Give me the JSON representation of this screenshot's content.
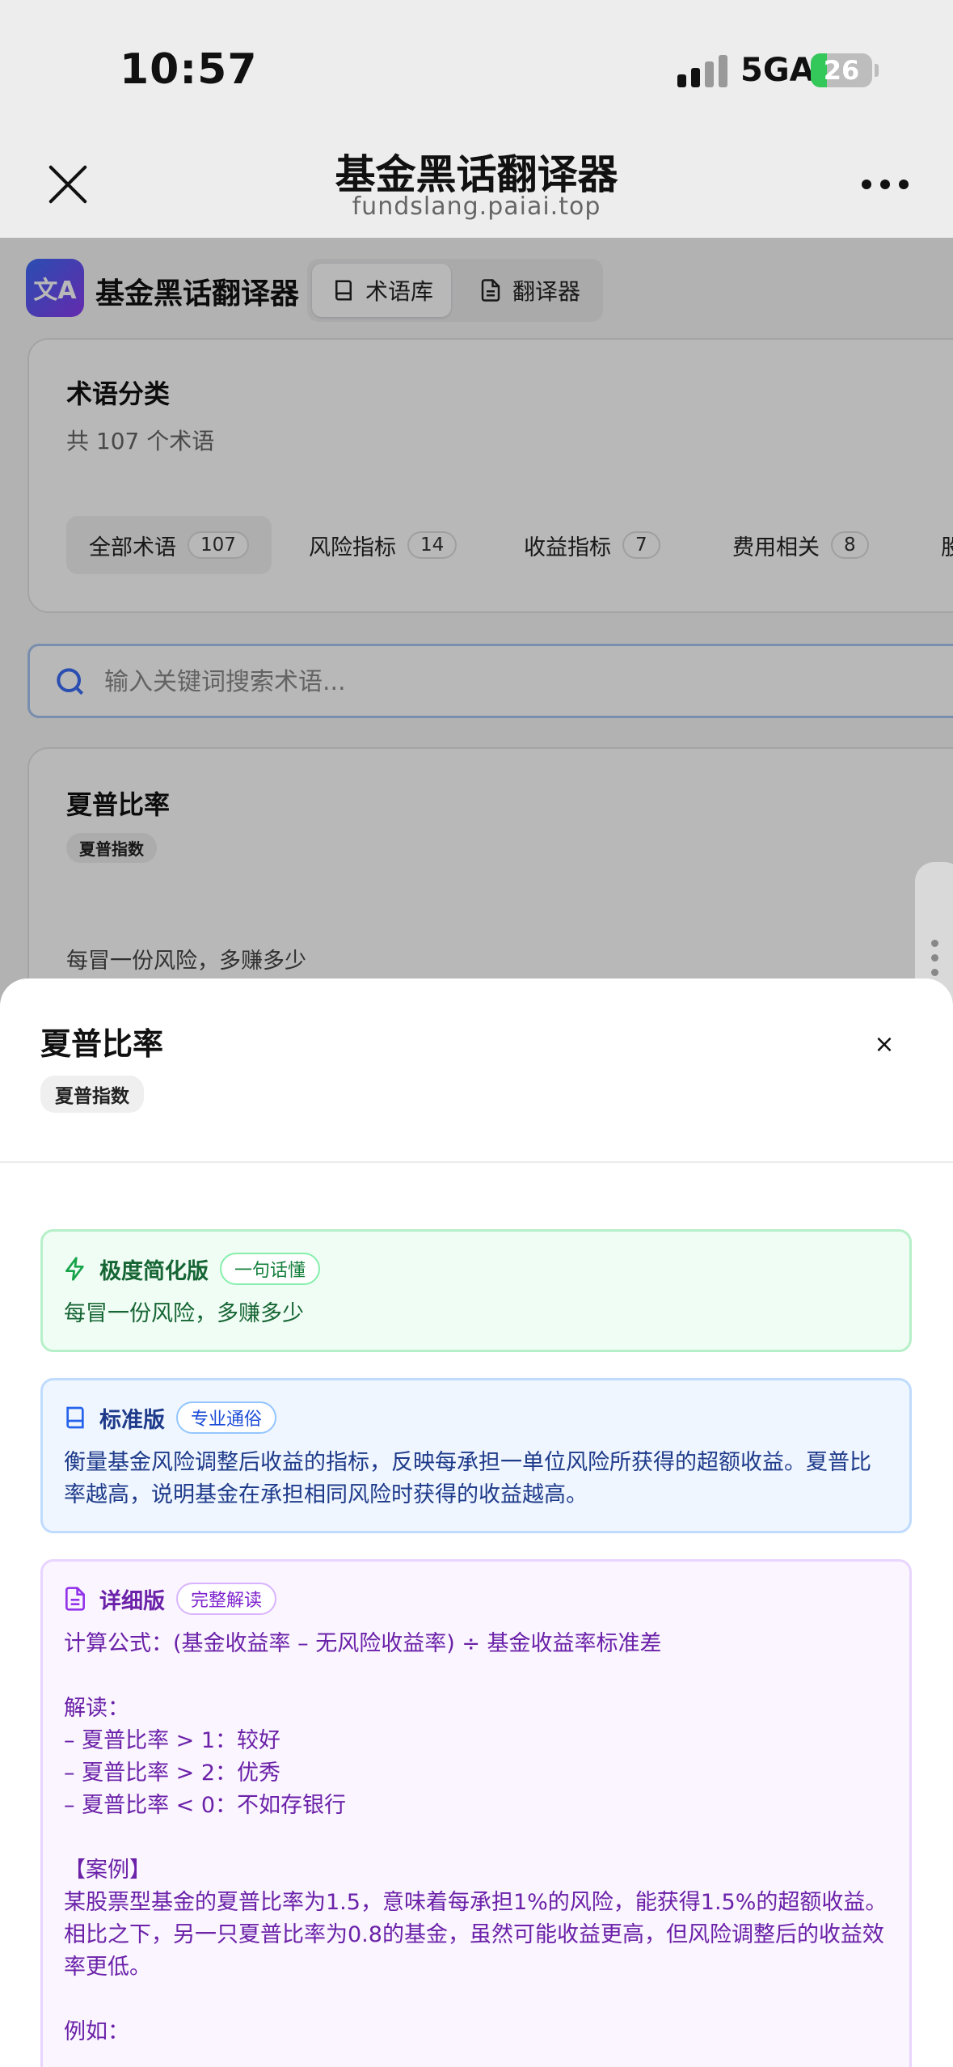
{
  "status_bar": {
    "time": "10:57",
    "network": "5GA",
    "battery": "26",
    "battery_level": 0.26
  },
  "browser": {
    "title": "基金黑话翻译器",
    "url": "fundslang.paiai.top"
  },
  "app": {
    "logo_glyph": "文A",
    "title": "基金黑话翻译器",
    "tabs": [
      {
        "label": "术语库",
        "active": true
      },
      {
        "label": "翻译器",
        "active": false
      }
    ]
  },
  "categories": {
    "title": "术语分类",
    "subtitle": "共 107 个术语",
    "items": [
      {
        "label": "全部术语",
        "count": "107",
        "active": true
      },
      {
        "label": "风险指标",
        "count": "14",
        "active": false
      },
      {
        "label": "收益指标",
        "count": "7",
        "active": false
      },
      {
        "label": "费用相关",
        "count": "8",
        "active": false
      },
      {
        "label": "股",
        "count": "",
        "active": false
      }
    ]
  },
  "search": {
    "placeholder": "输入关键词搜索术语..."
  },
  "term_card": {
    "title": "夏普比率",
    "tag": "夏普指数",
    "short": "每冒一份风险，多赚多少"
  },
  "sheet": {
    "title": "夏普比率",
    "tag": "夏普指数",
    "close_label": "×",
    "sections": {
      "simple": {
        "heading": "极度简化版",
        "badge": "一句话懂",
        "body": "每冒一份风险，多赚多少"
      },
      "standard": {
        "heading": "标准版",
        "badge": "专业通俗",
        "body": "衡量基金风险调整后收益的指标，反映每承担一单位风险所获得的超额收益。夏普比率越高，说明基金在承担相同风险时获得的收益越高。"
      },
      "detailed": {
        "heading": "详细版",
        "badge": "完整解读",
        "body": "计算公式：(基金收益率 – 无风险收益率) ÷ 基金收益率标准差\n\n解读：\n– 夏普比率 > 1：较好\n– 夏普比率 > 2：优秀\n– 夏普比率 < 0：不如存银行\n\n【案例】\n某股票型基金的夏普比率为1.5，意味着每承担1%的风险，能获得1.5%的超额收益。相比之下，另一只夏普比率为0.8的基金，虽然可能收益更高，但风险调整后的收益效率更低。\n\n例如："
      }
    }
  },
  "colors": {
    "accent_blue": "#3b6cf6",
    "accent_purple": "#8b3bf0",
    "green": "#166534",
    "blue": "#1e3a8a",
    "purple": "#6b21a8",
    "search_border": "#a8c4f2"
  }
}
